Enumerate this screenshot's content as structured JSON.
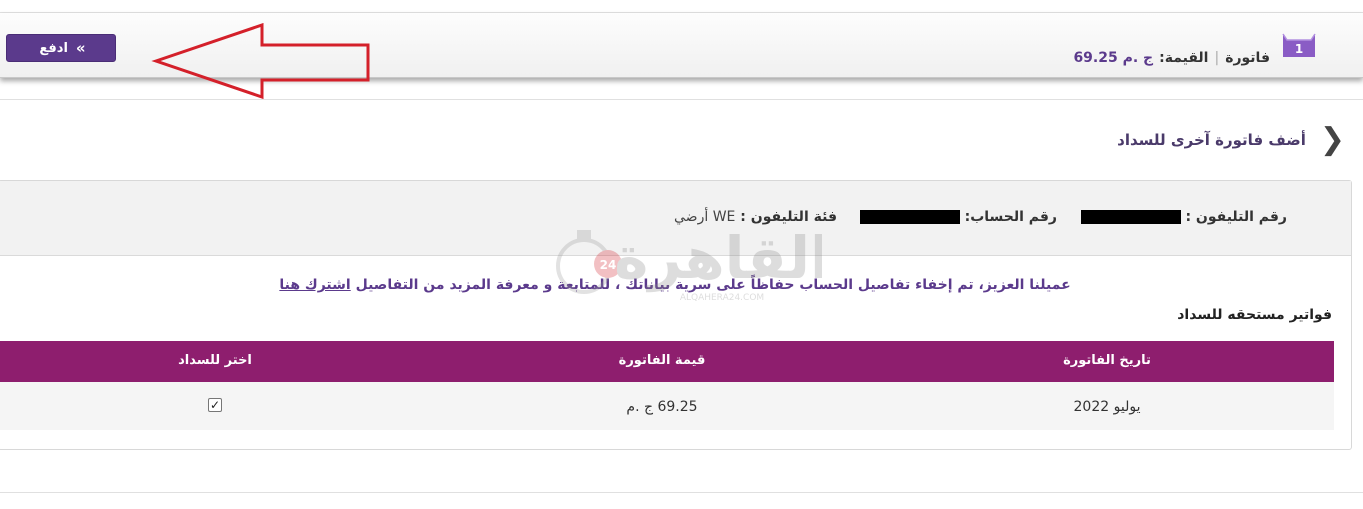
{
  "top_bar": {
    "pay_label": "ادفع",
    "pay_chevron": "«",
    "cart_count": "1",
    "invoice_label": "فاتورة",
    "separator": "|",
    "value_label": "القيمة:",
    "value_amount": "ج .م 69.25"
  },
  "add_bill": {
    "label": "أضف فاتورة آخرى للسداد",
    "chevron": "❮"
  },
  "account": {
    "phone_label": "رقم التليفون :",
    "account_label": "رقم الحساب:",
    "category_label": "فئة التليفون :",
    "category_value": "WE أرضي"
  },
  "notice": {
    "text": "عميلنا العزيز، تم إخفاء تفاصيل الحساب حفاظاً على سرية بياناتك ، للمتابعة و معرفة المزيد من التفاصيل",
    "link_text": "اشترك هنا"
  },
  "due_title": "فواتير مستحقه للسداد",
  "table": {
    "headers": [
      "تاريخ الفاتورة",
      "قيمة الفاتورة",
      "اختر للسداد"
    ],
    "rows": [
      {
        "date": "يوليو 2022",
        "amount": "69.25 ج .م",
        "check": "✓"
      }
    ]
  },
  "watermark": {
    "text": "القاهرة",
    "badge": "24",
    "sub": "ALQAHERA24.COM"
  },
  "colors": {
    "brand_purple": "#5b3a8c",
    "table_header": "#8e1e6e",
    "arrow_red": "#d4202a"
  }
}
